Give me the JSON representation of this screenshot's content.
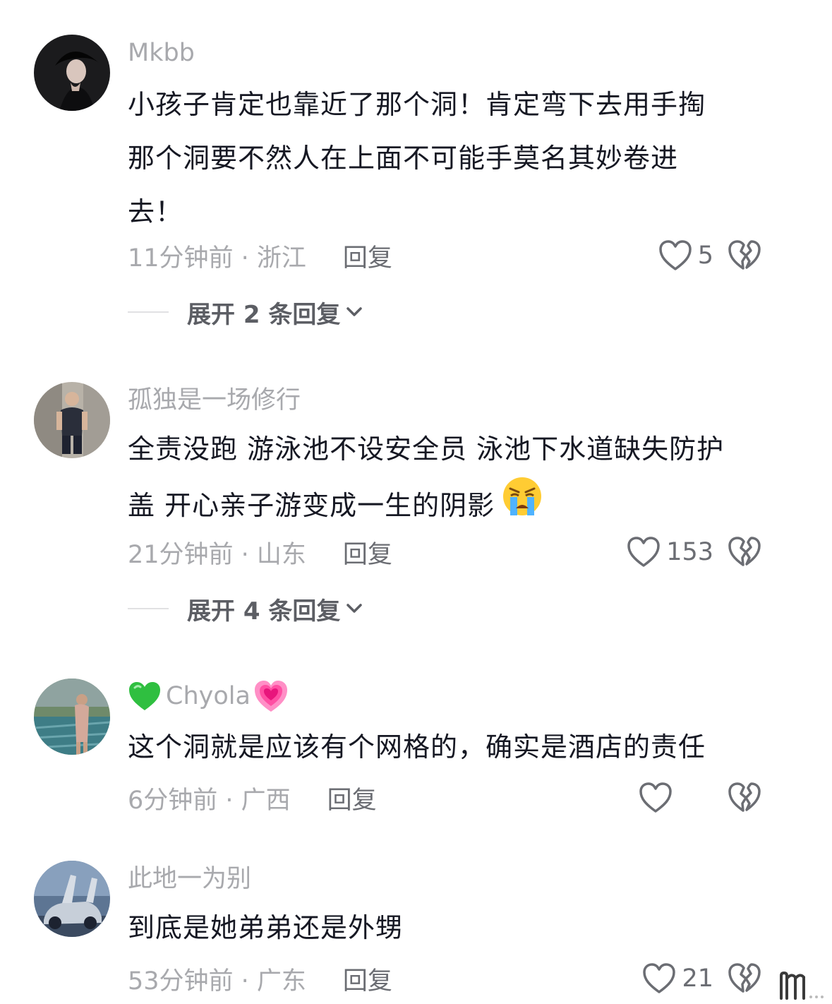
{
  "comments": [
    {
      "username": "Mkbb",
      "text_lines": [
        "小孩子肯定也靠近了那个洞！肯定弯下去用手掏",
        "那个洞要不然人在上面不可能手莫名其妙卷进",
        "去！"
      ],
      "time_location": "11分钟前 · 浙江",
      "reply_label": "回复",
      "likes": "5",
      "expand_label": "展开 2 条回复"
    },
    {
      "username": "孤独是一场修行",
      "text_lines": [
        "全责没跑 游泳池不设安全员 泳池下水道缺失防护",
        "盖 开心亲子游变成一生的阴影"
      ],
      "emoji": "crying-face-emoji",
      "time_location": "21分钟前 · 山东",
      "reply_label": "回复",
      "likes": "153",
      "expand_label": "展开 4 条回复"
    },
    {
      "username": "Chyola",
      "username_prefix_emoji": "green-heart-emoji",
      "username_suffix_emoji": "growing-heart-emoji",
      "text_lines": [
        "这个洞就是应该有个网格的，确实是酒店的责任"
      ],
      "time_location": "6分钟前 · 广西",
      "reply_label": "回复",
      "likes": ""
    },
    {
      "username": "此地一为别",
      "text_lines": [
        "到底是她弟弟还是外甥"
      ],
      "time_location": "53分钟前 · 广东",
      "reply_label": "回复",
      "likes": "21"
    }
  ],
  "icons": {
    "like": "heart-outline-icon",
    "dislike": "broken-heart-icon",
    "expand": "chevron-down-icon"
  },
  "colors": {
    "text": "#161823",
    "muted": "#a8a9ad",
    "secondary": "#6b6d73"
  }
}
